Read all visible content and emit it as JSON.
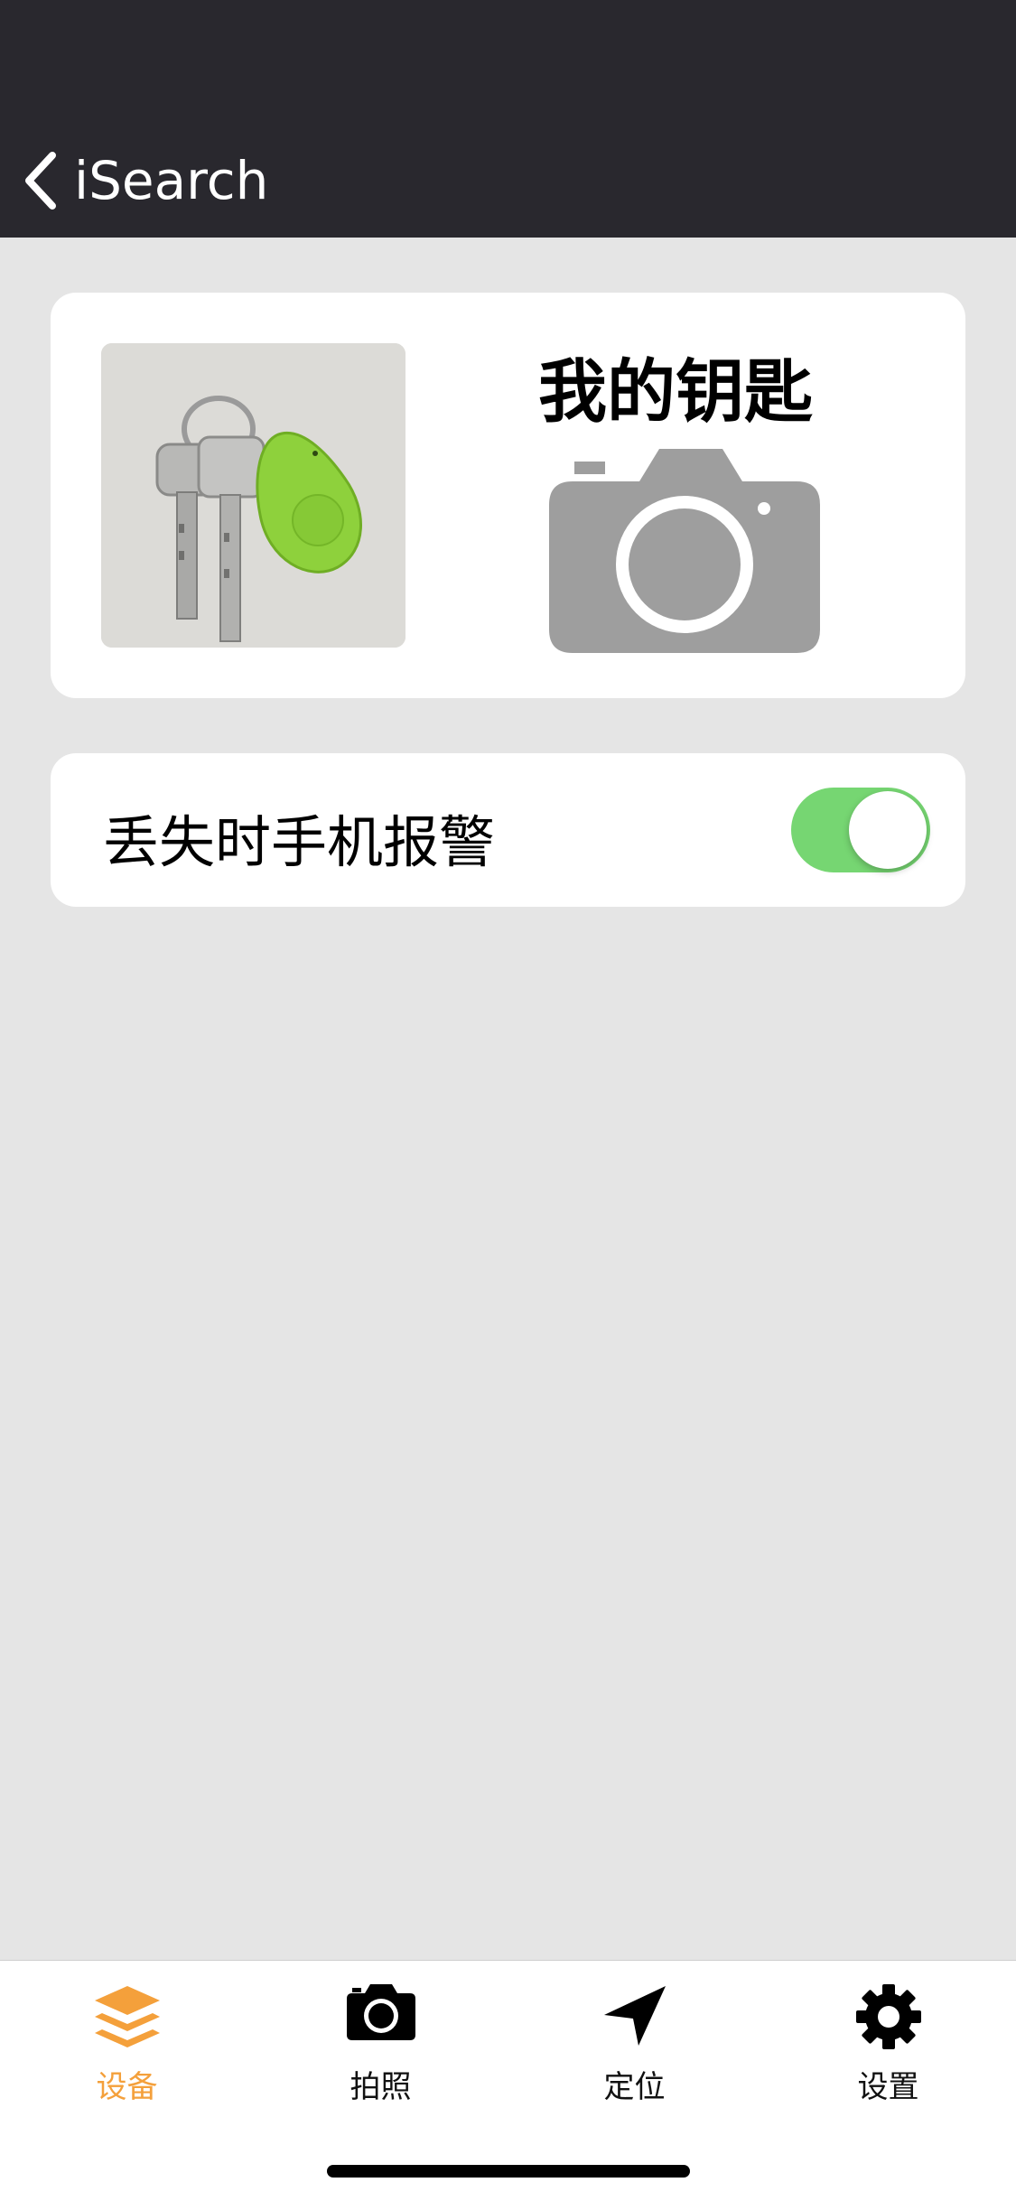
{
  "nav": {
    "back_label": "iSearch"
  },
  "device": {
    "name": "我的钥匙",
    "photo_icon": "keys-with-green-tracker-photo",
    "camera_icon": "camera-icon"
  },
  "alarm": {
    "label": "丢失时手机报警",
    "enabled": true
  },
  "tabs": [
    {
      "label": "设备",
      "icon": "layers-icon",
      "active": true
    },
    {
      "label": "拍照",
      "icon": "camera-icon",
      "active": false
    },
    {
      "label": "定位",
      "icon": "location-arrow-icon",
      "active": false
    },
    {
      "label": "设置",
      "icon": "gear-icon",
      "active": false
    }
  ],
  "colors": {
    "nav_background": "#29282e",
    "page_background": "#e5e5e5",
    "toggle_on": "#76d672",
    "tab_active": "#f4a03b",
    "camera_gray": "#9e9e9e"
  }
}
